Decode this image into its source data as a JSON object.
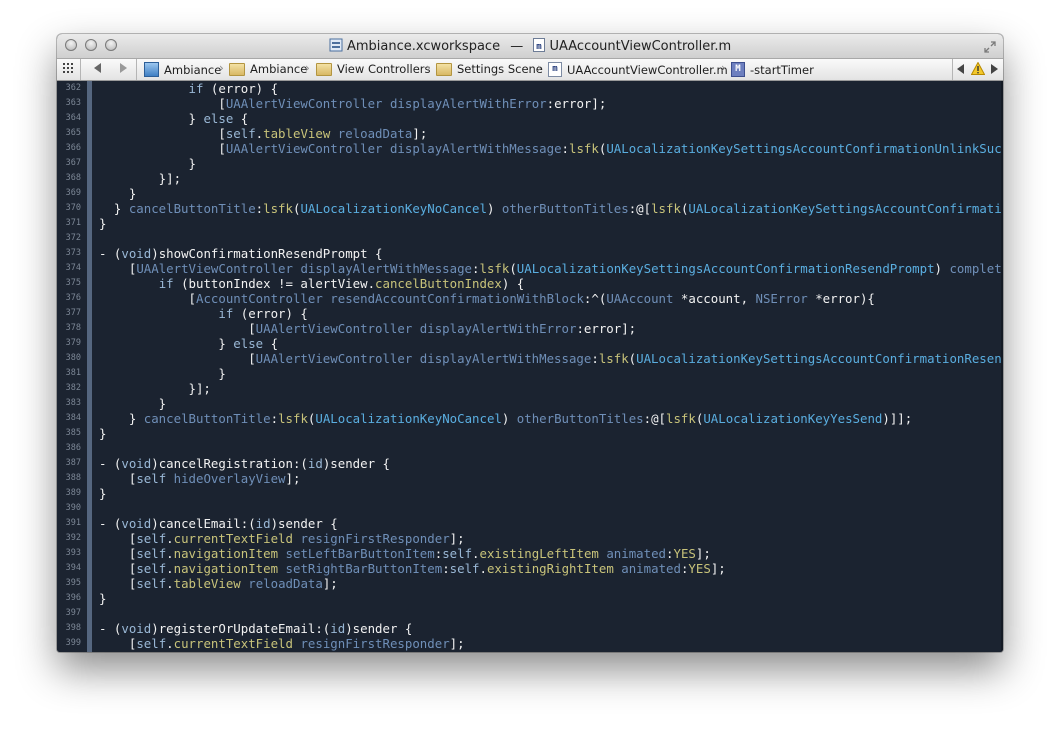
{
  "window": {
    "title_file": "Ambiance.xcworkspace",
    "title_separator": "—",
    "title_doc": "UAAccountViewController.m"
  },
  "jumpbar": {
    "items": [
      "Ambiance",
      "Ambiance",
      "View Controllers",
      "Settings Scene",
      "UAAccountViewController.m",
      "-startTimer"
    ],
    "separator": "›"
  },
  "colors": {
    "background": "#1b2330",
    "text": "#f2f2f2",
    "keyword": "#9ab8d6",
    "class": "#6f8fb8",
    "method": "#6f8fb8",
    "macro": "#c8c37a",
    "constant": "#5aaee0",
    "property": "#c8c37a",
    "line_number": "#7c8796"
  },
  "editor": {
    "lines": [
      {
        "n": "362",
        "t": "            if (error) {"
      },
      {
        "n": "363",
        "t": "                [UAAlertViewController displayAlertWithError:error];"
      },
      {
        "n": "364",
        "t": "            } else {"
      },
      {
        "n": "365",
        "t": "                [self.tableView reloadData];"
      },
      {
        "n": "366",
        "t": "                [UAAlertViewController displayAlertWithMessage:lsfk(UALocalizationKeySettingsAccountConfirmationUnlinkSucessf("
      },
      {
        "n": "367",
        "t": "            }"
      },
      {
        "n": "368",
        "t": "        }];"
      },
      {
        "n": "369",
        "t": "    }"
      },
      {
        "n": "370",
        "t": "  } cancelButtonTitle:lsfk(UALocalizationKeyNoCancel) otherButtonTitles:@[lsfk(UALocalizationKeySettingsAccountConfirmationUnlin"
      },
      {
        "n": "371",
        "t": "}"
      },
      {
        "n": "372",
        "t": ""
      },
      {
        "n": "373",
        "t": "- (void)showConfirmationResendPrompt {"
      },
      {
        "n": "374",
        "t": "    [UAAlertViewController displayAlertWithMessage:lsfk(UALocalizationKeySettingsAccountConfirmationResendPrompt) completionBlock"
      },
      {
        "n": "375",
        "t": "        if (buttonIndex != alertView.cancelButtonIndex) {"
      },
      {
        "n": "376",
        "t": "            [AccountController resendAccountConfirmationWithBlock:^(UAAccount *account, NSError *error){"
      },
      {
        "n": "377",
        "t": "                if (error) {"
      },
      {
        "n": "378",
        "t": "                    [UAAlertViewController displayAlertWithError:error];"
      },
      {
        "n": "379",
        "t": "                } else {"
      },
      {
        "n": "380",
        "t": "                    [UAAlertViewController displayAlertWithMessage:lsfk(UALocalizationKeySettingsAccountConfirmationResendSucessf("
      },
      {
        "n": "381",
        "t": "                }"
      },
      {
        "n": "382",
        "t": "            }];"
      },
      {
        "n": "383",
        "t": "        }"
      },
      {
        "n": "384",
        "t": "    } cancelButtonTitle:lsfk(UALocalizationKeyNoCancel) otherButtonTitles:@[lsfk(UALocalizationKeyYesSend)]];"
      },
      {
        "n": "385",
        "t": "}"
      },
      {
        "n": "386",
        "t": ""
      },
      {
        "n": "387",
        "t": "- (void)cancelRegistration:(id)sender {"
      },
      {
        "n": "388",
        "t": "    [self hideOverlayView];"
      },
      {
        "n": "389",
        "t": "}"
      },
      {
        "n": "390",
        "t": ""
      },
      {
        "n": "391",
        "t": "- (void)cancelEmail:(id)sender {"
      },
      {
        "n": "392",
        "t": "    [self.currentTextField resignFirstResponder];"
      },
      {
        "n": "393",
        "t": "    [self.navigationItem setLeftBarButtonItem:self.existingLeftItem animated:YES];"
      },
      {
        "n": "394",
        "t": "    [self.navigationItem setRightBarButtonItem:self.existingRightItem animated:YES];"
      },
      {
        "n": "395",
        "t": "    [self.tableView reloadData];"
      },
      {
        "n": "396",
        "t": "}"
      },
      {
        "n": "397",
        "t": ""
      },
      {
        "n": "398",
        "t": "- (void)registerOrUpdateEmail:(id)sender {"
      },
      {
        "n": "399",
        "t": "    [self.currentTextField resignFirstResponder];"
      }
    ]
  }
}
